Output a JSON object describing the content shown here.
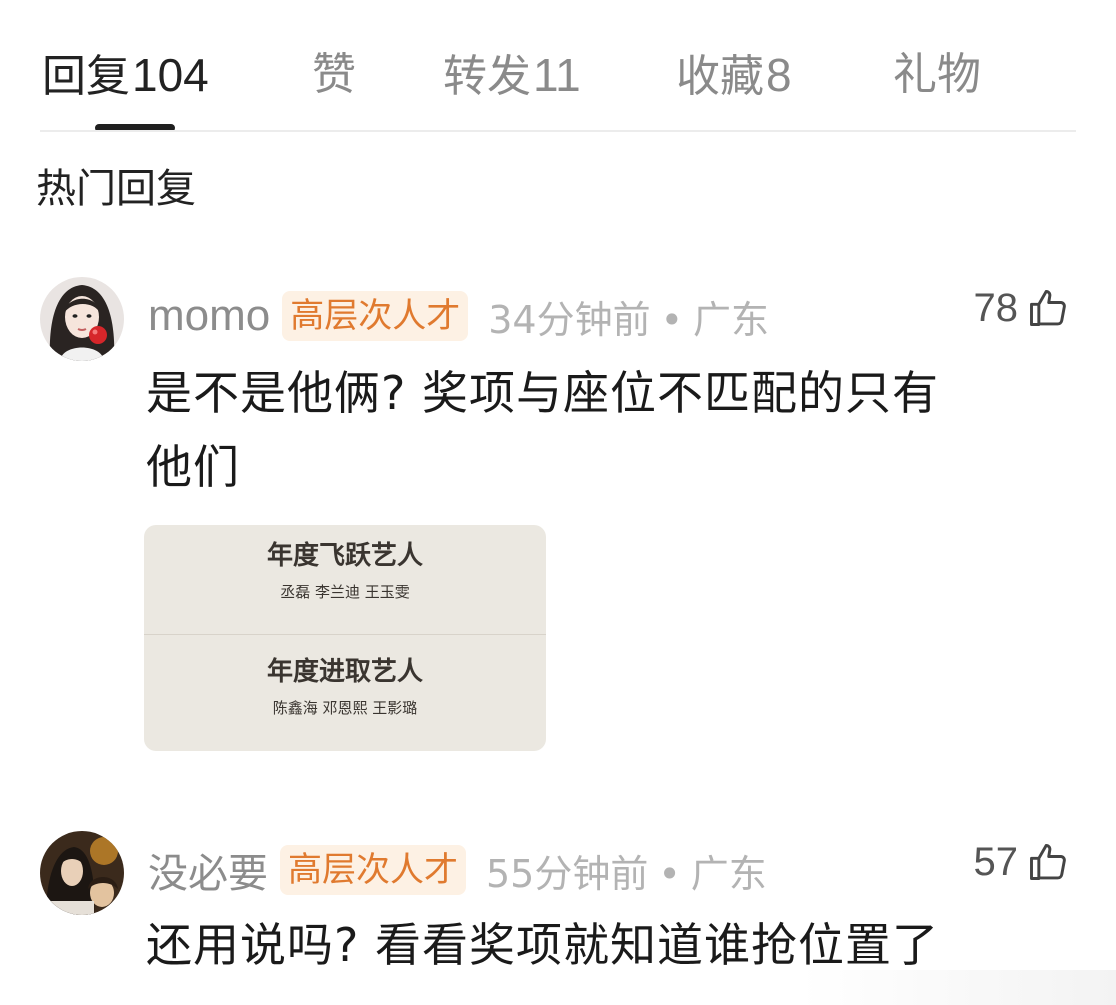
{
  "tabs": {
    "reply": {
      "label": "回复",
      "count": "104"
    },
    "like": {
      "label": "赞"
    },
    "repost": {
      "label": "转发",
      "count": "11"
    },
    "favorite": {
      "label": "收藏",
      "count": "8"
    },
    "gift": {
      "label": "礼物"
    },
    "active": "reply"
  },
  "section_title": "热门回复",
  "comments": [
    {
      "username": "momo",
      "badge": "高层次人才",
      "time": "34分钟前",
      "location": "广东",
      "likes": "78",
      "text_lines": [
        "是不是他俩? 奖项与座位不匹配的只有",
        "他们"
      ],
      "image": {
        "awards": [
          {
            "title": "年度飞跃艺人",
            "names": "丞磊  李兰迪  王玉雯"
          },
          {
            "title": "年度进取艺人",
            "names": "陈鑫海  邓恩熙  王影璐"
          }
        ]
      }
    },
    {
      "username": "没必要",
      "badge": "高层次人才",
      "time": "55分钟前",
      "location": "广东",
      "likes": "57",
      "text_lines": [
        "还用说吗? 看看奖项就知道谁抢位置了"
      ]
    }
  ],
  "colors": {
    "badge_text": "#e07a2f",
    "badge_bg": "#fdf1e4",
    "muted": "#8c8c8c",
    "indicator": "#1f1f1f"
  },
  "icons": {
    "like": "thumbs-up-outline-icon"
  }
}
